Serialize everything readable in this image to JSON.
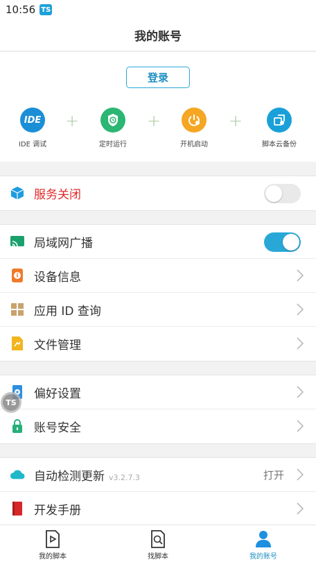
{
  "status_bar": {
    "time": "10:56",
    "badge": "TS"
  },
  "header": {
    "title": "我的账号"
  },
  "account": {
    "login_label": "登录",
    "features": [
      {
        "label": "IDE 调试",
        "icon": "ide-icon",
        "icon_text": "IDE",
        "color": "#1a8fd6"
      },
      {
        "label": "定时运行",
        "icon": "shield-clock-icon",
        "color": "#2bb673"
      },
      {
        "label": "开机启动",
        "icon": "power-icon",
        "color": "#f5a623"
      },
      {
        "label": "脚本云备份",
        "icon": "cloud-backup-icon",
        "color": "#1aa0d8"
      }
    ],
    "plus": "+"
  },
  "service": {
    "label": "服务关闭",
    "icon": "cube-icon",
    "label_color": "#e02a2a",
    "enabled": false
  },
  "group1": [
    {
      "label": "局域网广播",
      "icon": "cast-icon",
      "type": "toggle",
      "enabled": true
    },
    {
      "label": "设备信息",
      "icon": "device-info-icon",
      "type": "chevron"
    },
    {
      "label": "应用 ID 查询",
      "icon": "grid-icon",
      "type": "chevron"
    },
    {
      "label": "文件管理",
      "icon": "file-icon",
      "type": "chevron"
    }
  ],
  "group2": [
    {
      "label": "偏好设置",
      "icon": "settings-phone-icon",
      "type": "chevron"
    },
    {
      "label": "账号安全",
      "icon": "lock-icon",
      "type": "chevron"
    }
  ],
  "group3": [
    {
      "label": "自动检测更新",
      "version": "v3.2.7.3",
      "value": "打开",
      "icon": "cloud-icon",
      "type": "chevron"
    },
    {
      "label": "开发手册",
      "icon": "book-icon",
      "type": "chevron"
    }
  ],
  "floating_badge": "TS",
  "bottom_nav": [
    {
      "label": "我的脚本",
      "icon": "script-play-icon",
      "active": false
    },
    {
      "label": "找脚本",
      "icon": "search-doc-icon",
      "active": false
    },
    {
      "label": "我的账号",
      "icon": "user-icon",
      "active": true
    }
  ],
  "colors": {
    "accent": "#29a8d8",
    "danger": "#e02a2a"
  }
}
